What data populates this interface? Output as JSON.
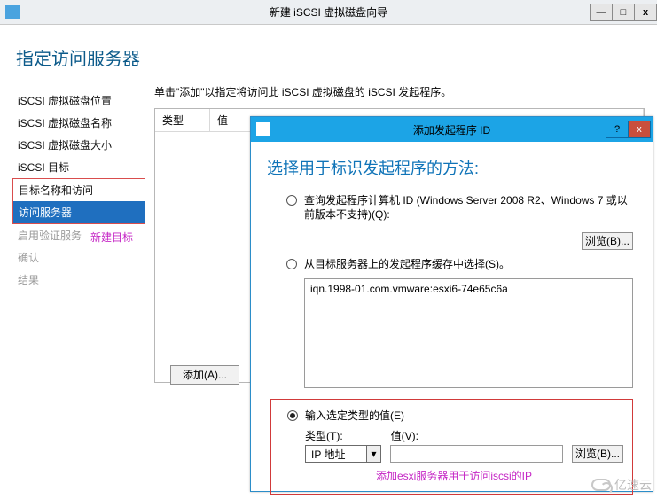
{
  "wizard": {
    "title": "新建 iSCSI 虚拟磁盘向导",
    "heading": "指定访问服务器",
    "instruction": "单击\"添加\"以指定将访问此 iSCSI 虚拟磁盘的 iSCSI 发起程序。",
    "columns": {
      "type": "类型",
      "value": "值"
    },
    "add_button": "添加(A)...",
    "winbtns": {
      "min": "—",
      "max": "□",
      "close": "x"
    }
  },
  "sidebar": {
    "items": [
      {
        "label": "iSCSI 虚拟磁盘位置",
        "state": "done"
      },
      {
        "label": "iSCSI 虚拟磁盘名称",
        "state": "done"
      },
      {
        "label": "iSCSI 虚拟磁盘大小",
        "state": "done"
      },
      {
        "label": "iSCSI 目标",
        "state": "done"
      },
      {
        "label": "目标名称和访问",
        "state": "highlight"
      },
      {
        "label": "访问服务器",
        "state": "selected"
      },
      {
        "label": "启用验证服务",
        "state": "disabled"
      },
      {
        "label": "确认",
        "state": "disabled"
      },
      {
        "label": "结果",
        "state": "disabled"
      }
    ],
    "annotation": "新建目标"
  },
  "dialog": {
    "title": "添加发起程序 ID",
    "heading": "选择用于标识发起程序的方法:",
    "winbtns": {
      "help": "?",
      "close": "x"
    },
    "opt_query": "查询发起程序计算机 ID (Windows Server 2008 R2、Windows 7 或以前版本不支持)(Q):",
    "browse_label": "浏览(B)...",
    "opt_select": "从目标服务器上的发起程序缓存中选择(S)。",
    "list_item": "iqn.1998-01.com.vmware:esxi6-74e65c6a",
    "opt_enter": "输入选定类型的值(E)",
    "type_label": "类型(T):",
    "value_label": "值(V):",
    "type_selected": "IP 地址",
    "annotation": "添加esxi服务器用于访问iscsi的IP"
  },
  "watermark": "亿速云"
}
